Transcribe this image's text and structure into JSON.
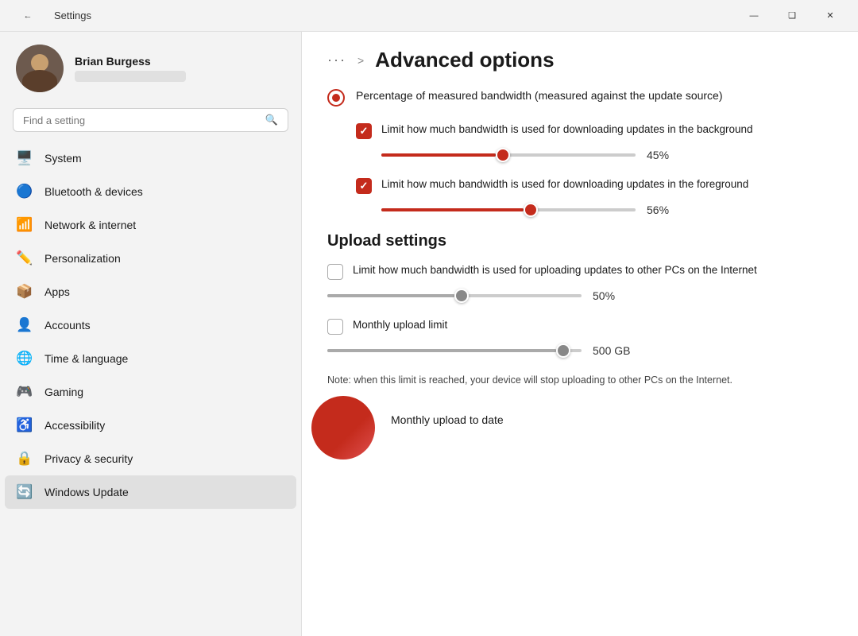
{
  "titlebar": {
    "back_icon": "←",
    "title": "Settings",
    "minimize_label": "—",
    "maximize_label": "❑",
    "close_label": "✕"
  },
  "sidebar": {
    "user": {
      "name": "Brian Burgess",
      "email": "••••••••••"
    },
    "search_placeholder": "Find a setting",
    "nav_items": [
      {
        "id": "system",
        "label": "System",
        "icon": "🖥️"
      },
      {
        "id": "bluetooth",
        "label": "Bluetooth & devices",
        "icon": "🔵"
      },
      {
        "id": "network",
        "label": "Network & internet",
        "icon": "📶"
      },
      {
        "id": "personalization",
        "label": "Personalization",
        "icon": "✏️"
      },
      {
        "id": "apps",
        "label": "Apps",
        "icon": "📦"
      },
      {
        "id": "accounts",
        "label": "Accounts",
        "icon": "👤"
      },
      {
        "id": "time",
        "label": "Time & language",
        "icon": "🌐"
      },
      {
        "id": "gaming",
        "label": "Gaming",
        "icon": "🎮"
      },
      {
        "id": "accessibility",
        "label": "Accessibility",
        "icon": "♿"
      },
      {
        "id": "privacy",
        "label": "Privacy & security",
        "icon": "🔒"
      },
      {
        "id": "update",
        "label": "Windows Update",
        "icon": "🔄",
        "active": true
      }
    ]
  },
  "content": {
    "breadcrumb_dots": "···",
    "breadcrumb_arrow": ">",
    "page_title": "Advanced options",
    "radio_label": "Percentage of measured bandwidth (measured against the update source)",
    "download_section": {
      "checkbox1_label": "Limit how much bandwidth is used for downloading updates in the background",
      "checkbox1_checked": true,
      "slider1_value": "45%",
      "slider1_pct": 45,
      "checkbox2_label": "Limit how much bandwidth is used for downloading updates in the foreground",
      "checkbox2_checked": true,
      "slider2_value": "56%",
      "slider2_pct": 56
    },
    "upload_section": {
      "title": "Upload settings",
      "checkbox3_label": "Limit how much bandwidth is used for uploading updates to other PCs on the Internet",
      "checkbox3_checked": false,
      "slider3_value": "50%",
      "slider3_pct": 50,
      "checkbox4_label": "Monthly upload limit",
      "checkbox4_checked": false,
      "slider4_value": "500 GB",
      "slider4_pct": 90,
      "note": "Note: when this limit is reached, your device will stop uploading to other PCs on the Internet.",
      "monthly_upload_label": "Monthly upload to date"
    }
  }
}
